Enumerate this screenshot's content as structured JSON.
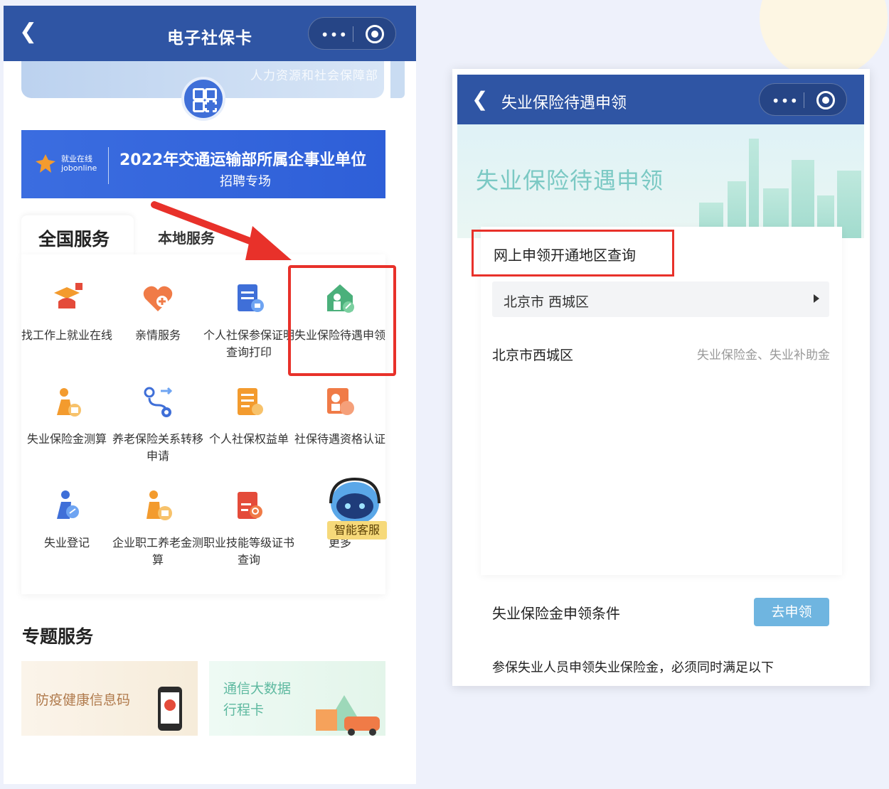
{
  "left_phone": {
    "nav": {
      "back_icon": "chevron-left-icon",
      "title": "电子社保卡",
      "more_icon": "more-dots-icon",
      "close_icon": "target-circle-icon"
    },
    "card_strip_text": "人力资源和社会保障部",
    "banner": {
      "logo_text_line1": "就业在线",
      "logo_text_line2": "jobonline",
      "title": "2022年交通运输部所属企事业单位",
      "subtitle": "招聘专场"
    },
    "tabs": [
      {
        "label": "全国服务",
        "active": true
      },
      {
        "label": "本地服务",
        "active": false
      }
    ],
    "services": [
      {
        "label": "找工作上就业在线",
        "icon": "job-online-icon"
      },
      {
        "label": "亲情服务",
        "icon": "heart-plus-icon"
      },
      {
        "label": "个人社保参保证明查询打印",
        "icon": "print-certificate-icon"
      },
      {
        "label": "失业保险待遇申领",
        "icon": "unemployment-claim-icon"
      },
      {
        "label": "失业保险金测算",
        "icon": "calculator-person-icon"
      },
      {
        "label": "养老保险关系转移申请",
        "icon": "transfer-route-icon"
      },
      {
        "label": "个人社保权益单",
        "icon": "document-edit-icon"
      },
      {
        "label": "社保待遇资格认证",
        "icon": "face-verify-icon"
      },
      {
        "label": "失业登记",
        "icon": "register-person-icon"
      },
      {
        "label": "企业职工养老金测算",
        "icon": "pension-calculator-icon"
      },
      {
        "label": "职业技能等级证书查询",
        "icon": "certificate-search-icon"
      },
      {
        "label": "更多",
        "icon": "more-icon"
      }
    ],
    "robot_tag": "智能客服",
    "section_title": "专题服务",
    "topics": [
      {
        "label": "防疫健康信息码"
      },
      {
        "line1": "通信大数据",
        "line2": "行程卡"
      }
    ],
    "highlight_color": "#e8312a"
  },
  "right_phone": {
    "nav": {
      "back_icon": "chevron-left-icon",
      "title": "失业保险待遇申领"
    },
    "hero_title": "失业保险待遇申领",
    "query_title": "网上申领开通地区查询",
    "dropdown_value": "北京市 西城区",
    "region": {
      "name": "北京市西城区",
      "items": "失业保险金、失业补助金"
    },
    "condition_title": "失业保险金申领条件",
    "apply_button": "去申领",
    "condition_text": "参保失业人员申领失业保险金，必须同时满足以下"
  },
  "colors": {
    "nav_bg": "#2f55a4",
    "accent_blue": "#3f6fd8",
    "teal_title": "#7bc9c4",
    "button": "#6fb5e0"
  }
}
